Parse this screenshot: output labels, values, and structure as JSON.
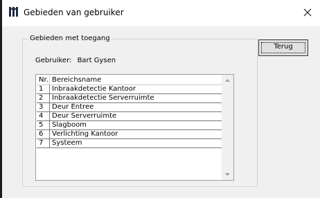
{
  "window": {
    "title": "Gebieden van gebruiker",
    "close_glyph": "×"
  },
  "group": {
    "label": "Gebieden met toegang"
  },
  "user": {
    "label": "Gebruiker:",
    "name": "Bart Gysen"
  },
  "list": {
    "headers": {
      "nr": "Nr.",
      "name": "Bereichsname"
    },
    "rows": [
      {
        "nr": "1",
        "name": "Inbraakdetectie Kantoor"
      },
      {
        "nr": "2",
        "name": "Inbraakdetectie Serverruimte"
      },
      {
        "nr": "3",
        "name": "Deur Entree"
      },
      {
        "nr": "4",
        "name": "Deur Serverruimte"
      },
      {
        "nr": "5",
        "name": "Slagboom"
      },
      {
        "nr": "6",
        "name": "Verlichting Kantoor"
      },
      {
        "nr": "7",
        "name": "Systeem"
      }
    ]
  },
  "buttons": {
    "back": "Terug"
  },
  "icons": {
    "app": "barrier-icon",
    "close": "close-icon",
    "scroll_up": "triangle-up-icon",
    "scroll_down": "triangle-down-icon"
  },
  "colors": {
    "window_bg": "#f0f0f0",
    "titlebar_bg": "#ffffff",
    "icon_color": "#1f2a44",
    "button_bg": "#e1e1e1"
  }
}
